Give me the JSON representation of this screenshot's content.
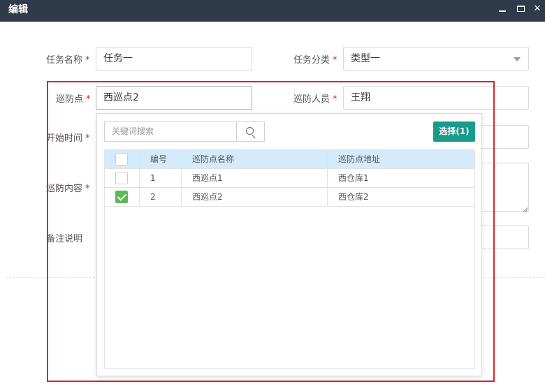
{
  "window": {
    "title": "编辑",
    "controls": {
      "minimize_icon": "minimize-icon",
      "maximize_icon": "maximize-icon",
      "close_icon": "close-icon",
      "close_glyph": "✕"
    }
  },
  "form": {
    "task_name": {
      "label": "任务名称",
      "value": "任务一",
      "required": true
    },
    "task_category": {
      "label": "任务分类",
      "value": "类型一",
      "required": true
    },
    "patrol_point": {
      "label": "巡防点",
      "value": "西巡点2",
      "required": true
    },
    "patrol_person": {
      "label": "巡防人员",
      "value": "王翔",
      "required": true
    },
    "start_time": {
      "label": "开始时间",
      "required": true
    },
    "patrol_content": {
      "label": "巡防内容",
      "required": true
    },
    "remark": {
      "label": "备注说明",
      "required": false
    },
    "required_mark": "*"
  },
  "picker": {
    "search_placeholder": "关键词搜索",
    "search_icon": "search-icon",
    "select_button": "选择(1)",
    "columns": [
      "编号",
      "巡防点名称",
      "巡防点地址"
    ],
    "rows": [
      {
        "id": "1",
        "name": "西巡点1",
        "address": "西仓库1",
        "checked": false
      },
      {
        "id": "2",
        "name": "西巡点2",
        "address": "西仓库2",
        "checked": true
      }
    ]
  },
  "colors": {
    "titlebar": "#2f3b4b",
    "accent": "#1a9a8b",
    "checkbox_checked": "#5cb85c",
    "table_header": "#d5ebfb",
    "required": "#e02020",
    "highlight_border": "#d9232c"
  }
}
